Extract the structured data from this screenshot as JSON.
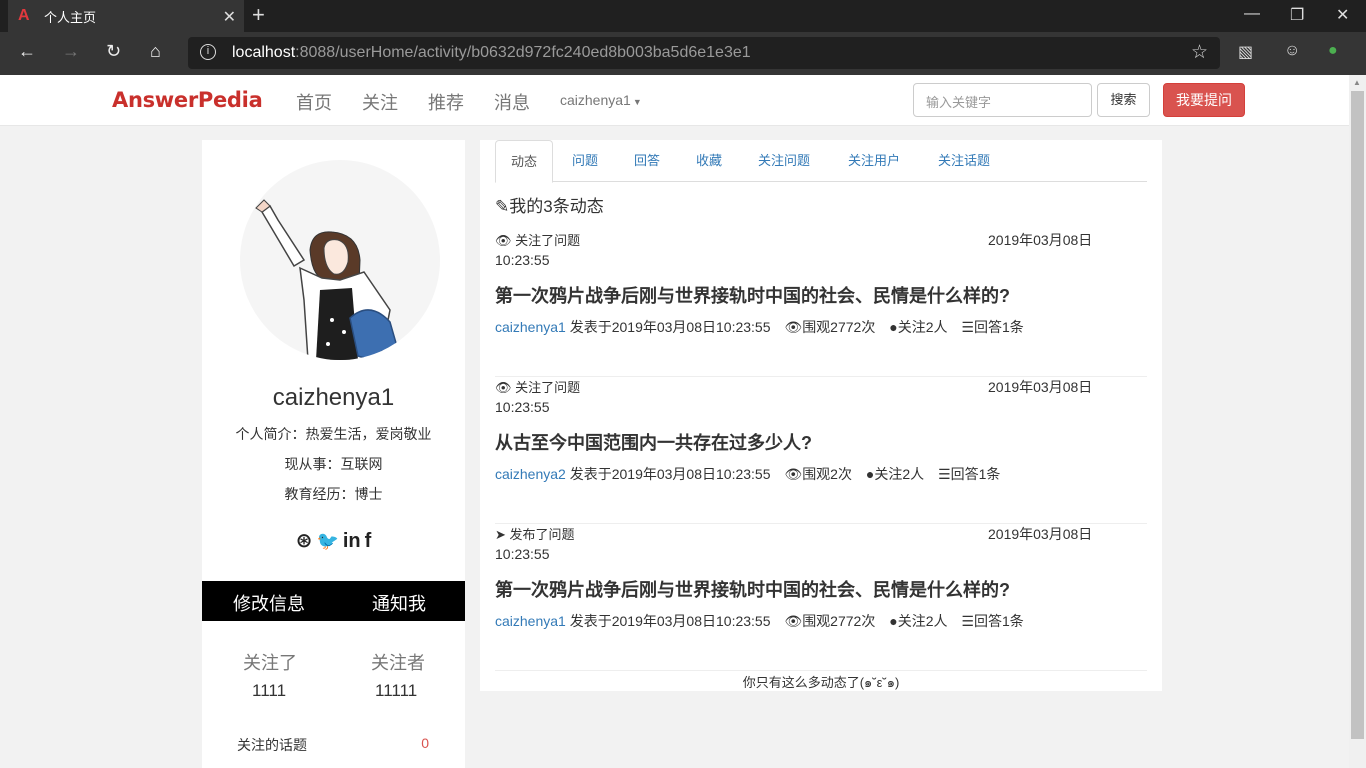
{
  "browser": {
    "tab_title": "个人主页",
    "url_host": "localhost",
    "url_rest": ":8088/userHome/activity/b0632d972fc240ed8b003ba5d6e1e3e1"
  },
  "header": {
    "logo": "AnswerPedia",
    "nav": [
      "首页",
      "关注",
      "推荐",
      "消息"
    ],
    "user": "caizhenya1",
    "search_placeholder": "输入关键字",
    "search_label": "搜索",
    "ask_label": "我要提问"
  },
  "profile": {
    "username": "caizhenya1",
    "bio": "个人简介：热爱生活，爱岗敬业",
    "job": "现从事：互联网",
    "edu": "教育经历：博士",
    "edit_label": "修改信息",
    "notify_label": "通知我",
    "following_label": "关注了",
    "following_count": "1111",
    "followers_label": "关注者",
    "followers_count": "11111",
    "topics_label": "关注的话题",
    "topics_count": "0"
  },
  "tabs": [
    "动态",
    "问题",
    "回答",
    "收藏",
    "关注问题",
    "关注用户",
    "关注话题"
  ],
  "feed": {
    "title": "我的3条动态",
    "end_text": "你只有这么多动态了(๑˘ε˘๑)",
    "items": [
      {
        "action": "关注了问题",
        "date": "2019年03月08日",
        "time": "10:23:55",
        "question": "第一次鸦片战争后刚与世界接轨时中国的社会、民情是什么样的?",
        "author": "caizhenya1",
        "posted": "发表于2019年03月08日10:23:55",
        "views": "围观2772次",
        "follows": "关注2人",
        "answers": "回答1条"
      },
      {
        "action": "关注了问题",
        "date": "2019年03月08日",
        "time": "10:23:55",
        "question": "从古至今中国范围内一共存在过多少人?",
        "author": "caizhenya2",
        "posted": "发表于2019年03月08日10:23:55",
        "views": "围观2次",
        "follows": "关注2人",
        "answers": "回答1条"
      },
      {
        "action": "发布了问题",
        "date": "2019年03月08日",
        "time": "10:23:55",
        "question": "第一次鸦片战争后刚与世界接轨时中国的社会、民情是什么样的?",
        "author": "caizhenya1",
        "posted": "发表于2019年03月08日10:23:55",
        "views": "围观2772次",
        "follows": "关注2人",
        "answers": "回答1条"
      }
    ]
  }
}
